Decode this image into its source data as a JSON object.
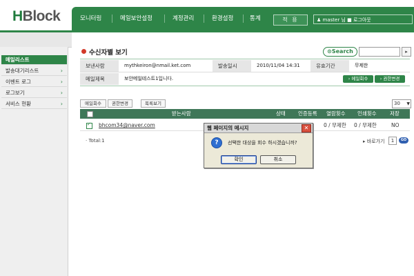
{
  "app": {
    "logo": "HBlock",
    "logo_first": "H",
    "logo_rest": "Block"
  },
  "nav": {
    "items": [
      "모니터링",
      "메일보안설정",
      "계정관리",
      "환경설정",
      "통계"
    ],
    "confirm": "적 용",
    "user": "master 님",
    "logout": "로그아웃"
  },
  "sidebar": {
    "items": [
      {
        "label": "메일리스트",
        "active": true
      },
      {
        "label": "발송대기리스트",
        "active": false
      },
      {
        "label": "이벤트 로그",
        "active": false
      },
      {
        "label": "로그보기",
        "active": false
      },
      {
        "label": "서비스 현황",
        "active": false
      }
    ]
  },
  "page": {
    "title": "수신자별 보기",
    "search_label": "Search",
    "search_value": "",
    "search_go": "▸"
  },
  "info": {
    "sender_label": "보낸사람",
    "sender": "mythkeiron@nmail.ket.com",
    "sent_label": "발송일시",
    "sent": "2010/11/04 14:31",
    "expire_label": "유효기간",
    "expire": "무제한",
    "subject_label": "메일제목",
    "subject": "보안메일테스트1입니다.",
    "recall_button": "메일회수",
    "permission_button": "권한변경"
  },
  "list": {
    "toolbar": {
      "recall": "메일회수",
      "perm": "권한변경",
      "list": "목록보기"
    },
    "page_size": "30",
    "headers": {
      "recipient": "받는사람",
      "status": "상태",
      "auth": "인증등록",
      "view": "열람횟수",
      "print": "인쇄횟수",
      "save": "저장"
    },
    "rows": [
      {
        "recipient": "bhcom34@naver.com",
        "view": "0 / 무제한",
        "print": "0 / 무제한",
        "save": "NO",
        "checked": true
      }
    ],
    "total": "· Total:1",
    "goto_label": "▸ 바로가기",
    "goto_value": "1",
    "goto_btn": "GO"
  },
  "dialog": {
    "title": "웹 페이지의 메시지",
    "close": "✕",
    "icon": "?",
    "message": "선택한 대상을 회수 하시겠습니까?",
    "ok": "확인",
    "cancel": "취소"
  },
  "colors": {
    "brand": "#2e8548",
    "header_row": "#3f7758",
    "accent_red": "#d23a2a"
  }
}
